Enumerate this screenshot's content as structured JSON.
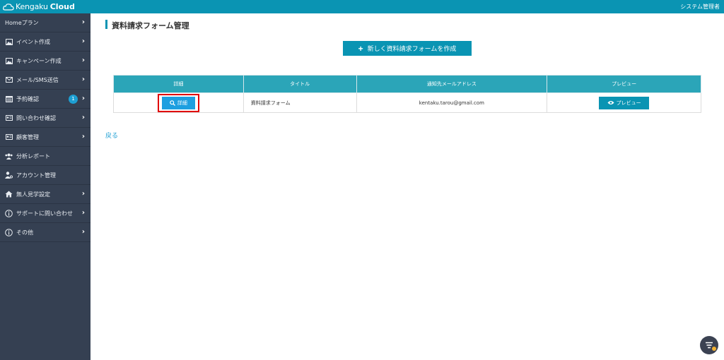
{
  "app": {
    "logo_part1": "Kengaku",
    "logo_part2": "Cloud",
    "user_role": "システム管理者"
  },
  "sidebar": {
    "items": [
      {
        "label": "Homeプラン",
        "icon": "home-plan",
        "chevron": true
      },
      {
        "label": "イベント作成",
        "icon": "image-icon",
        "chevron": true
      },
      {
        "label": "キャンペーン作成",
        "icon": "image-icon",
        "chevron": true
      },
      {
        "label": "メール/SMS送信",
        "icon": "mail-icon",
        "chevron": true
      },
      {
        "label": "予約確認",
        "icon": "calendar-icon",
        "chevron": true,
        "badge": "1"
      },
      {
        "label": "問い合わせ確認",
        "icon": "id-card-icon",
        "chevron": true
      },
      {
        "label": "顧客管理",
        "icon": "id-card-icon",
        "chevron": true
      },
      {
        "label": "分析レポート",
        "icon": "users-icon",
        "chevron": false
      },
      {
        "label": "アカウント管理",
        "icon": "user-settings-icon",
        "chevron": false
      },
      {
        "label": "無人見学設定",
        "icon": "house-icon",
        "chevron": true
      },
      {
        "label": "サポートに問い合わせ",
        "icon": "info-icon",
        "chevron": true
      },
      {
        "label": "その他",
        "icon": "info-icon",
        "chevron": true
      }
    ]
  },
  "main": {
    "page_title": "資料請求フォーム管理",
    "create_button": "新しく資料請求フォームを作成",
    "table": {
      "headers": [
        "詳細",
        "タイトル",
        "通知先メールアドレス",
        "プレビュー"
      ],
      "rows": [
        {
          "detail_button": "詳細",
          "title": "資料請求フォーム",
          "email": "kentaku.tarou@gmail.com",
          "preview_button": "プレビュー"
        }
      ]
    },
    "back_link": "戻る"
  },
  "colors": {
    "topbar": "#0a94b3",
    "sidebar": "#354052",
    "table_header": "#2ba5b8",
    "detail_button": "#1d9fe0",
    "highlight": "#e00000"
  }
}
